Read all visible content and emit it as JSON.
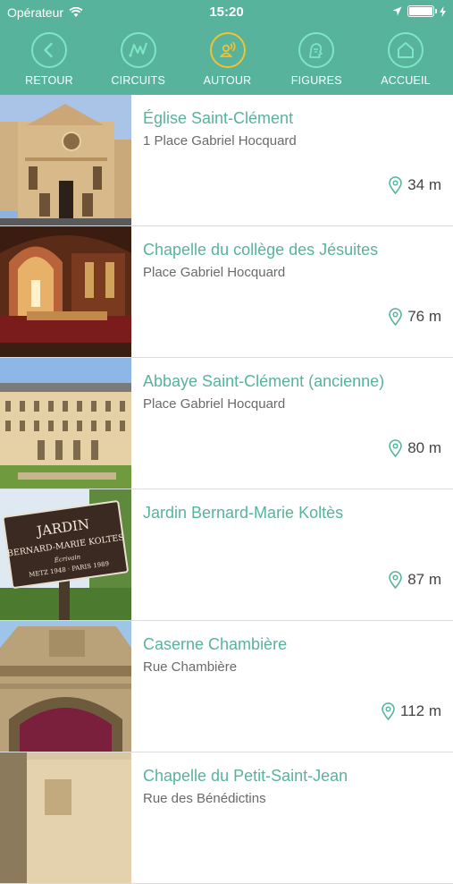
{
  "status_bar": {
    "carrier": "Opérateur",
    "time": "15:20",
    "battery_level": 1.0
  },
  "nav": {
    "items": [
      {
        "label": "RETOUR",
        "icon": "chevron-left-icon"
      },
      {
        "label": "CIRCUITS",
        "icon": "circuits-path-icon"
      },
      {
        "label": "AUTOUR",
        "icon": "nearby-person-icon"
      },
      {
        "label": "FIGURES",
        "icon": "figures-portrait-icon"
      },
      {
        "label": "ACCUEIL",
        "icon": "home-icon"
      }
    ],
    "active": "AUTOUR"
  },
  "places": [
    {
      "title": "Église Saint-Clément",
      "address": "1 Place Gabriel Hocquard",
      "distance": "34 m",
      "image": "church-facade"
    },
    {
      "title": "Chapelle du collège des Jésuites",
      "address": "Place Gabriel Hocquard",
      "distance": "76 m",
      "image": "chapel-interior"
    },
    {
      "title": "Abbaye Saint-Clément (ancienne)",
      "address": "Place Gabriel Hocquard",
      "distance": "80 m",
      "image": "abbey-building"
    },
    {
      "title": "Jardin Bernard-Marie Koltès",
      "address": "",
      "distance": "87 m",
      "image": "garden-sign"
    },
    {
      "title": "Caserne Chambière",
      "address": "Rue Chambière",
      "distance": "112 m",
      "image": "barracks-gate"
    },
    {
      "title": "Chapelle du Petit-Saint-Jean",
      "address": "Rue des Bénédictins",
      "distance": "",
      "image": "small-chapel"
    }
  ],
  "sign_text": {
    "line1": "JARDIN",
    "line2": "BERNARD-MARIE KOLTES",
    "line3": "Écrivain",
    "line4": "METZ 1948 · PARIS 1989"
  },
  "colors": {
    "header": "#58b39d",
    "nav_circle": "#7de6c3",
    "active": "#f2c230",
    "title": "#58b39d",
    "address": "#6a6a6a"
  }
}
